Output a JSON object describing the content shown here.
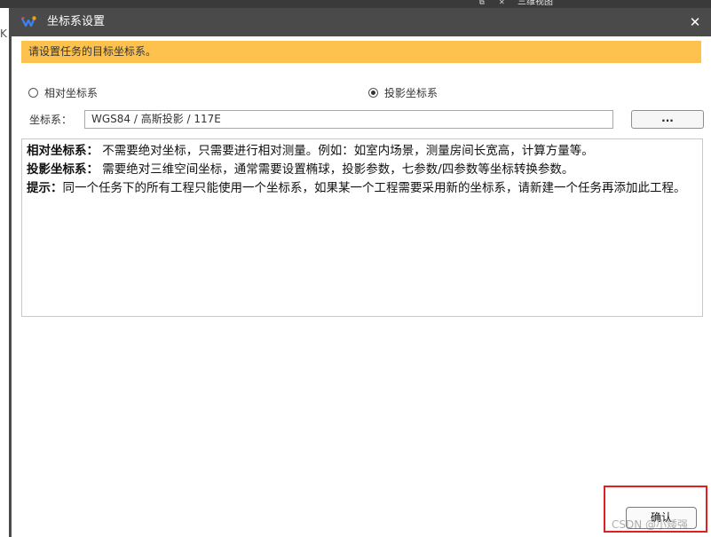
{
  "background": {
    "tab_label": "三维视图",
    "left_glyph": "K"
  },
  "dialog": {
    "title": "坐标系设置",
    "close_glyph": "✕",
    "notice": "请设置任务的目标坐标系。",
    "radio_relative": {
      "label": "相对坐标系",
      "checked": false
    },
    "radio_projected": {
      "label": "投影坐标系",
      "checked": true
    },
    "coord_label": "坐标系：",
    "coord_value": "WGS84 / 高斯投影 / 117E",
    "browse_label": "...",
    "descriptions": [
      {
        "term": "相对坐标系：",
        "text": "  不需要绝对坐标，只需要进行相对测量。例如：如室内场景，测量房间长宽高，计算方量等。"
      },
      {
        "term": "投影坐标系：",
        "text": "  需要绝对三维空间坐标，通常需要设置椭球，投影参数，七参数/四参数等坐标转换参数。"
      },
      {
        "term": "提示：",
        "text": "同一个任务下的所有工程只能使用一个坐标系，如果某一个工程需要采用新的坐标系，请新建一个任务再添加此工程。"
      }
    ],
    "ok_label": "确认"
  },
  "watermark": "CSDN @小矮强",
  "colors": {
    "titlebar": "#4a4a4a",
    "notice_bg": "#fdc24d",
    "highlight": "#e02020"
  },
  "icons": {
    "app": "app-logo-icon",
    "close": "close-icon"
  }
}
